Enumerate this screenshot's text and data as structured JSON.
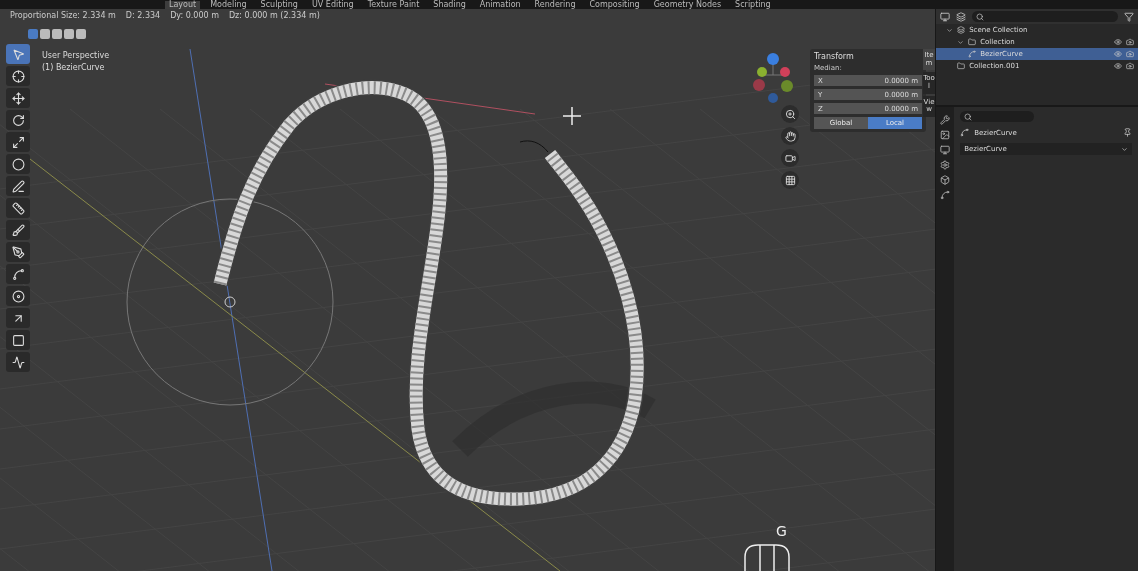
{
  "workspace_tabs": [
    {
      "label": "Layout",
      "selected": true
    },
    {
      "label": "Modeling",
      "selected": false
    },
    {
      "label": "Sculpting",
      "selected": false
    },
    {
      "label": "UV Editing",
      "selected": false
    },
    {
      "label": "Texture Paint",
      "selected": false
    },
    {
      "label": "Shading",
      "selected": false
    },
    {
      "label": "Animation",
      "selected": false
    },
    {
      "label": "Rendering",
      "selected": false
    },
    {
      "label": "Compositing",
      "selected": false
    },
    {
      "label": "Geometry Nodes",
      "selected": false
    },
    {
      "label": "Scripting",
      "selected": false
    }
  ],
  "header_status": [
    "Proportional Size: 2.334 m",
    "D: 2.334",
    "Dy: 0.000 m",
    "Dz: 0.000 m (2.334 m)"
  ],
  "viewport": {
    "view_name": "User Perspective",
    "object_name": "(1) BezierCurve",
    "key_hint": "G"
  },
  "tools": [
    {
      "kind": "select",
      "selected": true
    },
    {
      "kind": "cursor",
      "selected": false
    },
    {
      "kind": "move",
      "selected": false
    },
    {
      "kind": "rotate",
      "selected": false
    },
    {
      "kind": "scale",
      "selected": false
    },
    {
      "kind": "transform",
      "selected": false
    },
    {
      "kind": "annotate",
      "selected": false
    },
    {
      "kind": "measure",
      "selected": false
    },
    {
      "kind": "draw",
      "selected": false
    },
    {
      "kind": "pen",
      "selected": false
    },
    {
      "kind": "tilt",
      "selected": false
    },
    {
      "kind": "radius",
      "selected": false
    },
    {
      "kind": "extrude",
      "selected": false
    },
    {
      "kind": "plane",
      "selected": false
    },
    {
      "kind": "curve",
      "selected": false
    }
  ],
  "transform_panel": {
    "title": "Transform",
    "label": "Median:",
    "fields": [
      {
        "axis": "X",
        "value": "0.0000 m"
      },
      {
        "axis": "Y",
        "value": "0.0000 m"
      },
      {
        "axis": "Z",
        "value": "0.0000 m"
      }
    ],
    "modes": [
      {
        "label": "Global",
        "selected": false
      },
      {
        "label": "Local",
        "selected": true
      }
    ]
  },
  "sidebar_tabs": [
    {
      "label": "Item",
      "selected": true
    },
    {
      "label": "Tool",
      "selected": false
    },
    {
      "label": "View",
      "selected": false
    }
  ],
  "outliner": {
    "items": [
      {
        "label": "Scene Collection",
        "kind": "scene",
        "selected": false,
        "children": [
          {
            "label": "Collection",
            "kind": "collection",
            "selected": false,
            "children": [
              {
                "label": "BezierCurve",
                "kind": "curve",
                "selected": true
              }
            ]
          },
          {
            "label": "Collection.001",
            "kind": "collection",
            "selected": false
          }
        ]
      }
    ]
  },
  "properties": {
    "object_name": "BezierCurve",
    "dropdown": "BezierCurve"
  }
}
